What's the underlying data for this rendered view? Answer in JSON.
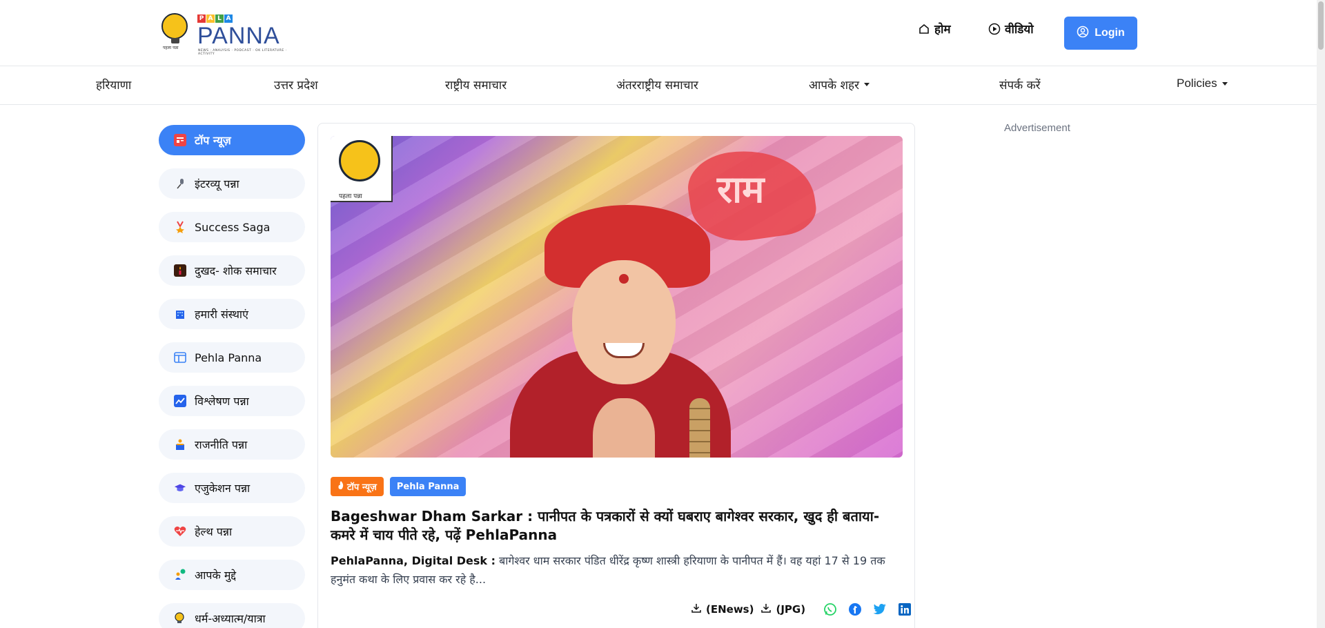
{
  "brand": {
    "logo_text": "PANNA",
    "logo_top_letters": [
      "P",
      "A",
      "L",
      "A"
    ],
    "logo_tagline": "NEWS · ANALYSIS · PODCAST · OK LITERATURE · ACTIVITY",
    "logo_small": "पहला पन्ना"
  },
  "header": {
    "home_label": "होम",
    "video_label": "वीडियो",
    "login_label": "Login"
  },
  "categories": [
    {
      "label": "हरियाणा"
    },
    {
      "label": "उत्तर प्रदेश"
    },
    {
      "label": "राष्ट्रीय समाचार"
    },
    {
      "label": "अंतरराष्ट्रीय समाचार"
    },
    {
      "label": "आपके शहर"
    },
    {
      "label": "संपर्क करें"
    },
    {
      "label": "Policies"
    }
  ],
  "sidebar": {
    "items": [
      {
        "label": "टॉप न्यूज़",
        "icon": "newspaper-icon",
        "color": "#ef4444"
      },
      {
        "label": "इंटरव्यू पन्ना",
        "icon": "microphone-icon",
        "color": "#6b7280"
      },
      {
        "label": "Success Saga",
        "icon": "medal-icon",
        "color": "#f59e0b"
      },
      {
        "label": "दुखद- शोक समाचार",
        "icon": "candle-icon",
        "color": "#7c2d12"
      },
      {
        "label": "हमारी संस्थाएं",
        "icon": "building-icon",
        "color": "#2563eb"
      },
      {
        "label": "Pehla Panna",
        "icon": "layout-icon",
        "color": "#3b82f6"
      },
      {
        "label": "विश्लेषण पन्ना",
        "icon": "chart-icon",
        "color": "#2563eb"
      },
      {
        "label": "राजनीति पन्ना",
        "icon": "podium-icon",
        "color": "#f59e0b"
      },
      {
        "label": "एजुकेशन पन्ना",
        "icon": "graduation-cap-icon",
        "color": "#4f46e5"
      },
      {
        "label": "हेल्थ पन्ना",
        "icon": "heart-pulse-icon",
        "color": "#ef4444"
      },
      {
        "label": "आपके मुद्दे",
        "icon": "people-icon",
        "color": "#10b981"
      },
      {
        "label": "धर्म-अध्यात्म/यात्रा",
        "icon": "lamp-icon",
        "color": "#f59e0b"
      }
    ]
  },
  "article": {
    "hero_flag_text": "राम",
    "badge_text": "पहला पन्ना",
    "tags": [
      {
        "label": "टॉप न्यूज़",
        "color": "#f97316"
      },
      {
        "label": "Pehla Panna",
        "color": "#3b82f6"
      }
    ],
    "title": "Bageshwar Dham Sarkar : पानीपत के पत्रकारों से क्यों घबराए बागेश्वर सरकार, खुद ही बताया- कमरे में चाय पीते रहे, पढ़ें PehlaPanna",
    "byline": "PehlaPanna, Digital Desk :",
    "summary": "बागेश्वर धाम सरकार पंडित धीरेंद्र कृष्ण शास्त्री हरियाणा के पानीपत में हैं। वह यहां 17 से 19 तक हनुमंत कथा के लिए प्रवास कर रहे है...",
    "download_enews": "(ENews)",
    "download_jpg": "(JPG)",
    "share": [
      {
        "name": "whatsapp-icon",
        "color": "#25d366"
      },
      {
        "name": "facebook-icon",
        "color": "#1877f2"
      },
      {
        "name": "twitter-icon",
        "color": "#1da1f2"
      },
      {
        "name": "linkedin-icon",
        "color": "#0a66c2"
      }
    ]
  },
  "ad": {
    "label": "Advertisement"
  }
}
